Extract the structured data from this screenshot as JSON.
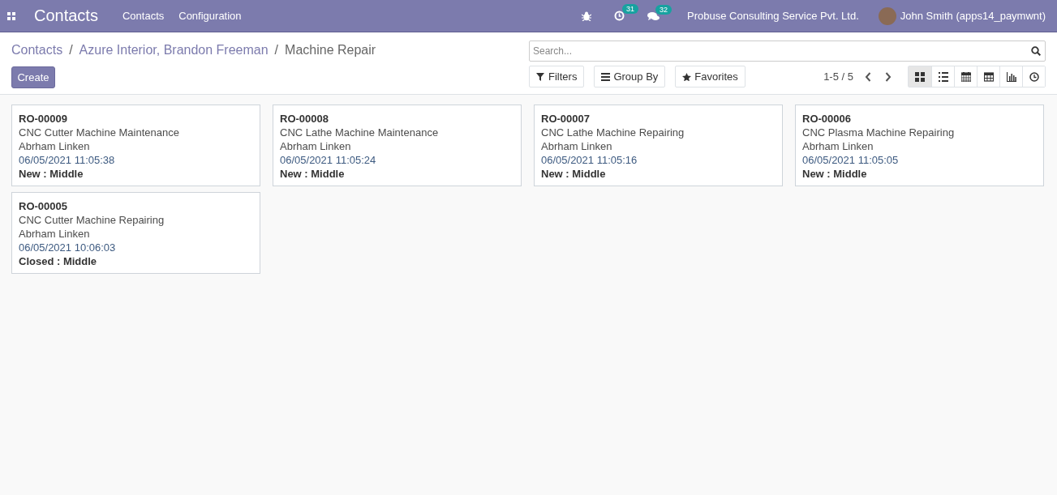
{
  "navbar": {
    "app_title": "Contacts",
    "menu": [
      "Contacts",
      "Configuration"
    ],
    "activity_count": "31",
    "message_count": "32",
    "company": "Probuse Consulting Service Pvt. Ltd.",
    "user": "John Smith (apps14_paymwnt)"
  },
  "breadcrumb": [
    {
      "label": "Contacts",
      "kind": "link"
    },
    {
      "label": "Azure Interior, Brandon Freeman",
      "kind": "link"
    },
    {
      "label": "Machine Repair",
      "kind": "current"
    }
  ],
  "breadcrumb_separators": [
    "/",
    "/"
  ],
  "create_button": "Create",
  "search": {
    "placeholder": "Search..."
  },
  "filters": [
    {
      "label": "Filters",
      "kind": "filter"
    },
    {
      "label": "Group By",
      "kind": "group"
    },
    {
      "label": "Favorites",
      "kind": "star"
    }
  ],
  "pager": "1-5 / 5",
  "views": [
    {
      "kind": "kanban",
      "selected": true
    },
    {
      "kind": "list",
      "selected": false
    },
    {
      "kind": "calendar",
      "selected": false
    },
    {
      "kind": "pivot",
      "selected": false
    },
    {
      "kind": "graph",
      "selected": false
    },
    {
      "kind": "activity",
      "selected": false
    }
  ],
  "cards": [
    {
      "reference": "RO-00009",
      "subject": "CNC Cutter Machine Maintenance",
      "customer": "Abrham Linken",
      "date": "06/05/2021 11:05:38",
      "stage": "New : Middle"
    },
    {
      "reference": "RO-00008",
      "subject": "CNC Lathe Machine Maintenance",
      "customer": "Abrham Linken",
      "date": "06/05/2021 11:05:24",
      "stage": "New : Middle"
    },
    {
      "reference": "RO-00007",
      "subject": "CNC Lathe Machine Repairing",
      "customer": "Abrham Linken",
      "date": "06/05/2021 11:05:16",
      "stage": "New : Middle"
    },
    {
      "reference": "RO-00006",
      "subject": "CNC Plasma Machine Repairing",
      "customer": "Abrham Linken",
      "date": "06/05/2021 11:05:05",
      "stage": "New : Middle"
    },
    {
      "reference": "RO-00005",
      "subject": "CNC Cutter Machine Repairing",
      "customer": "Abrham Linken",
      "date": "06/05/2021 10:06:03",
      "stage": "Closed : Middle"
    }
  ]
}
